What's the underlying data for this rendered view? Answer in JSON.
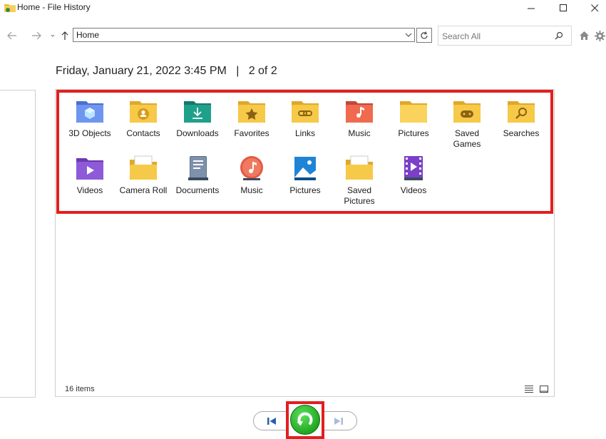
{
  "window": {
    "title": "Home - File History"
  },
  "nav": {
    "address": "Home",
    "search_placeholder": "Search All"
  },
  "header": {
    "date": "Friday, January 21, 2022 3:45 PM",
    "separator": "|",
    "page": "2 of 2"
  },
  "items": [
    {
      "label": "3D Objects",
      "icon": "3d-objects-folder-icon"
    },
    {
      "label": "Contacts",
      "icon": "contacts-folder-icon"
    },
    {
      "label": "Downloads",
      "icon": "downloads-folder-icon"
    },
    {
      "label": "Favorites",
      "icon": "favorites-folder-icon"
    },
    {
      "label": "Links",
      "icon": "links-folder-icon"
    },
    {
      "label": "Music",
      "icon": "music-folder-icon"
    },
    {
      "label": "Pictures",
      "icon": "pictures-folder-icon"
    },
    {
      "label": "Saved Games",
      "icon": "saved-games-folder-icon"
    },
    {
      "label": "Searches",
      "icon": "searches-folder-icon"
    },
    {
      "label": "Videos",
      "icon": "videos-folder-icon"
    },
    {
      "label": "Camera Roll",
      "icon": "camera-roll-folder-icon"
    },
    {
      "label": "Documents",
      "icon": "documents-library-icon"
    },
    {
      "label": "Music",
      "icon": "music-library-icon"
    },
    {
      "label": "Pictures",
      "icon": "pictures-library-icon"
    },
    {
      "label": "Saved Pictures",
      "icon": "saved-pictures-folder-icon"
    },
    {
      "label": "Videos",
      "icon": "videos-library-icon"
    }
  ],
  "status": {
    "count": "16 items"
  },
  "colors": {
    "highlight": "#e02020",
    "folder": "#f7c948",
    "restore": "#21a821"
  }
}
